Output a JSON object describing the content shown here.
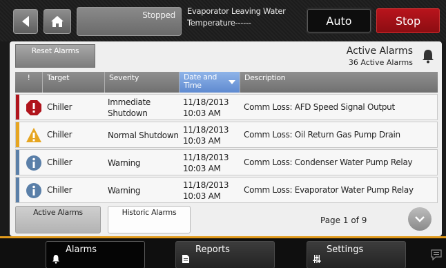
{
  "header": {
    "status": "Stopped",
    "evap_line1": "Evaporator Leaving Water",
    "evap_line2": "Temperature------",
    "auto_label": "Auto",
    "stop_label": "Stop"
  },
  "alarms": {
    "reset_label": "Reset Alarms",
    "title": "Active Alarms",
    "subtitle": "36 Active Alarms",
    "columns": [
      "!",
      "Target",
      "Severity",
      "Date and Time",
      "Description"
    ],
    "rows": [
      {
        "icon": "error-icon",
        "color": "#b0141c",
        "target": "Chiller",
        "severity": "Immediate Shutdown",
        "date": "11/18/2013",
        "time": "10:03 AM",
        "description": "Comm Loss: AFD Speed Signal Output"
      },
      {
        "icon": "warning-triangle-icon",
        "color": "#e6a520",
        "target": "Chiller",
        "severity": "Normal Shutdown",
        "date": "11/18/2013",
        "time": "10:03 AM",
        "description": "Comm Loss: Oil Return Gas Pump Drain"
      },
      {
        "icon": "info-icon",
        "color": "#5a7fa8",
        "target": "Chiller",
        "severity": "Warning",
        "date": "11/18/2013",
        "time": "10:03 AM",
        "description": "Comm Loss: Condenser Water Pump Relay"
      },
      {
        "icon": "info-icon",
        "color": "#5a7fa8",
        "target": "Chiller",
        "severity": "Warning",
        "date": "11/18/2013",
        "time": "10:03 AM",
        "description": "Comm Loss: Evaporator Water Pump Relay"
      }
    ],
    "tab_active": "Active Alarms",
    "tab_historic": "Historic Alarms",
    "page_label": "Page 1 of 9"
  },
  "nav": {
    "alarms": "Alarms",
    "reports": "Reports",
    "settings": "Settings"
  }
}
